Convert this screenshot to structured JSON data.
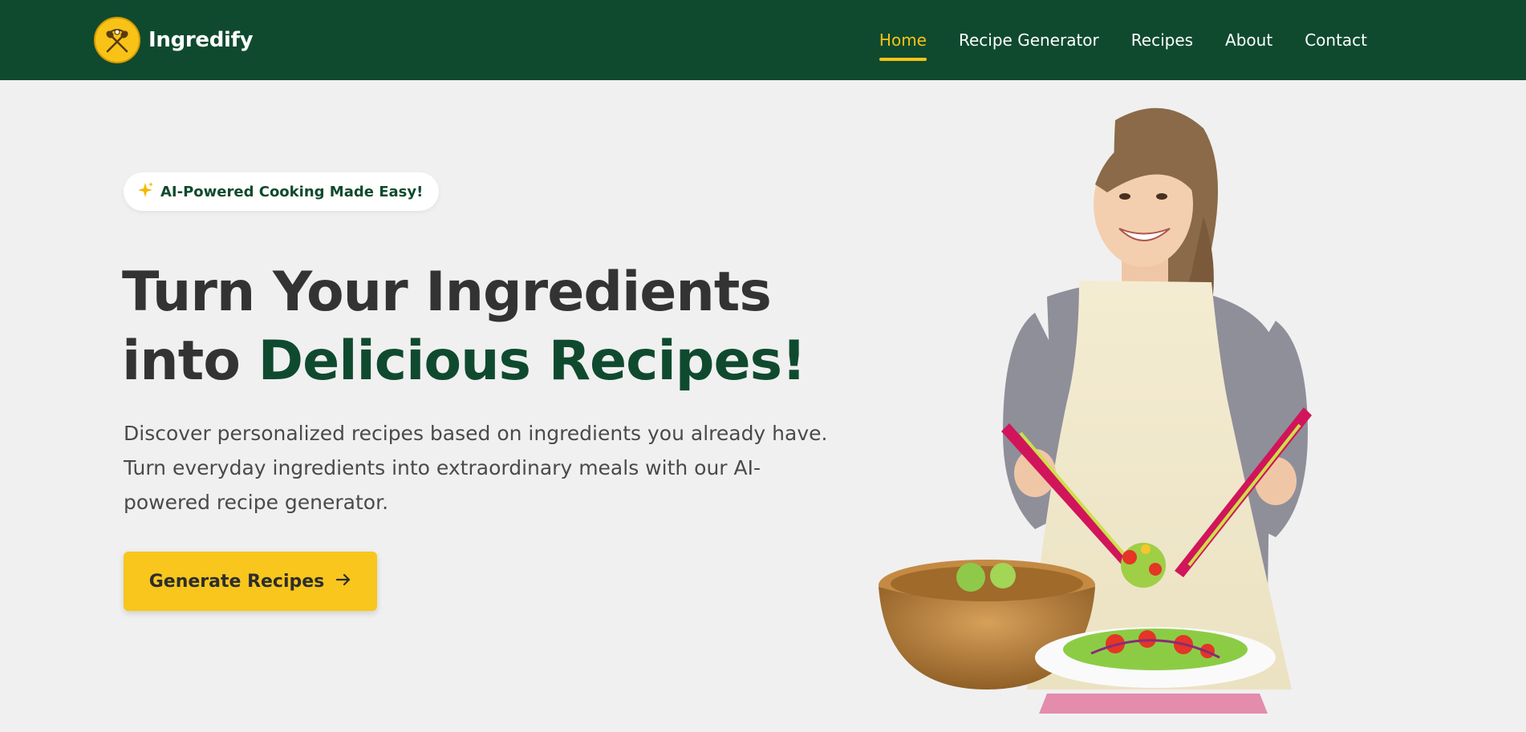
{
  "brand": {
    "name": "Ingredify",
    "logo_icon": "cooking-utensils-logo"
  },
  "nav": {
    "items": [
      {
        "label": "Home",
        "active": true
      },
      {
        "label": "Recipe Generator",
        "active": false
      },
      {
        "label": "Recipes",
        "active": false
      },
      {
        "label": "About",
        "active": false
      },
      {
        "label": "Contact",
        "active": false
      }
    ]
  },
  "hero": {
    "badge": {
      "icon": "sparkle-icon",
      "text": "AI-Powered Cooking Made Easy!"
    },
    "headline": {
      "line1": "Turn Your Ingredients",
      "line2_prefix": "into ",
      "line2_accent": "Delicious Recipes!"
    },
    "description": "Discover personalized recipes based on ingredients you already have. Turn everyday ingredients into extraordinary meals with our AI-powered recipe generator.",
    "cta": {
      "label": "Generate Recipes",
      "icon": "arrow-right-icon"
    },
    "image": {
      "subject": "woman-tossing-salad"
    }
  },
  "colors": {
    "primary": "#0f4a2f",
    "accent": "#f8c316",
    "background": "#f0f0f0",
    "text": "#333333"
  }
}
